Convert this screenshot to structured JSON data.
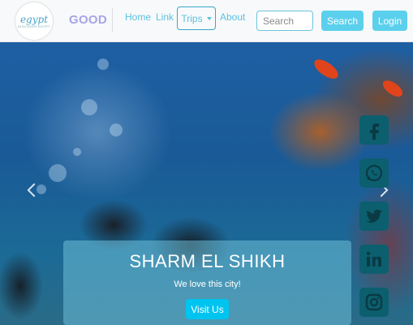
{
  "brand": {
    "logo_text": "egypt",
    "logo_subtext": "DISCOVER EGYPT",
    "name": "GOOD"
  },
  "nav": {
    "links": [
      "Home",
      "Link"
    ],
    "dropdown_label": "Trips",
    "about_label": "About"
  },
  "search": {
    "placeholder": "Search",
    "button_label": "Search"
  },
  "login_label": "Login",
  "carousel": {
    "title": "SHARM EL SHIKH",
    "text": "We love this city!",
    "button_label": "Visit Us"
  },
  "social": [
    "facebook-icon",
    "whatsapp-icon",
    "twitter-icon",
    "linkedin-icon",
    "instagram-icon"
  ],
  "colors": {
    "accent": "#5bd0ec",
    "brand": "#a9a4e6",
    "social_bg": "#0c5f6e",
    "hero_button": "#00c4f0"
  }
}
